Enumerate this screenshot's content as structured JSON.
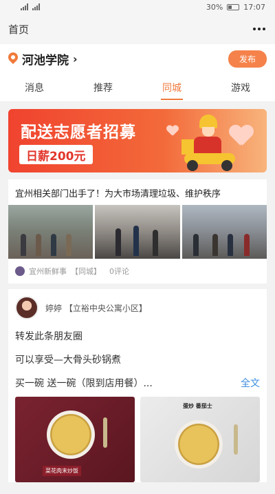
{
  "status_bar": {
    "battery": "30%",
    "time": "17:07"
  },
  "header": {
    "title": "首页"
  },
  "location": {
    "name": "河池学院",
    "publish_label": "发布"
  },
  "tabs": [
    {
      "label": "消息",
      "active": false
    },
    {
      "label": "推荐",
      "active": false
    },
    {
      "label": "同城",
      "active": true
    },
    {
      "label": "游戏",
      "active": false
    }
  ],
  "banner": {
    "title": "配送志愿者招募",
    "pay": "日薪200元"
  },
  "news": {
    "title": "宜州相关部门出手了！为大市场清理垃圾、维护秩序",
    "source": "宜州新鲜事",
    "tag": "【同城】",
    "comments": "0评论"
  },
  "post": {
    "user": "婷婷",
    "place": "【立裕中央公寓小区】",
    "lines": [
      "转发此条朋友圈",
      "可以享受—大骨头砂锅煮",
      "买一碗  送一碗（限到店用餐）..."
    ],
    "full_text": "全文",
    "pic1_label": "菜花肉末炒饭",
    "pic2_title": "蛋炒  番茄士"
  },
  "colors": {
    "accent": "#f07a3c",
    "banner": "#f0432f",
    "link": "#3d8ee0"
  }
}
